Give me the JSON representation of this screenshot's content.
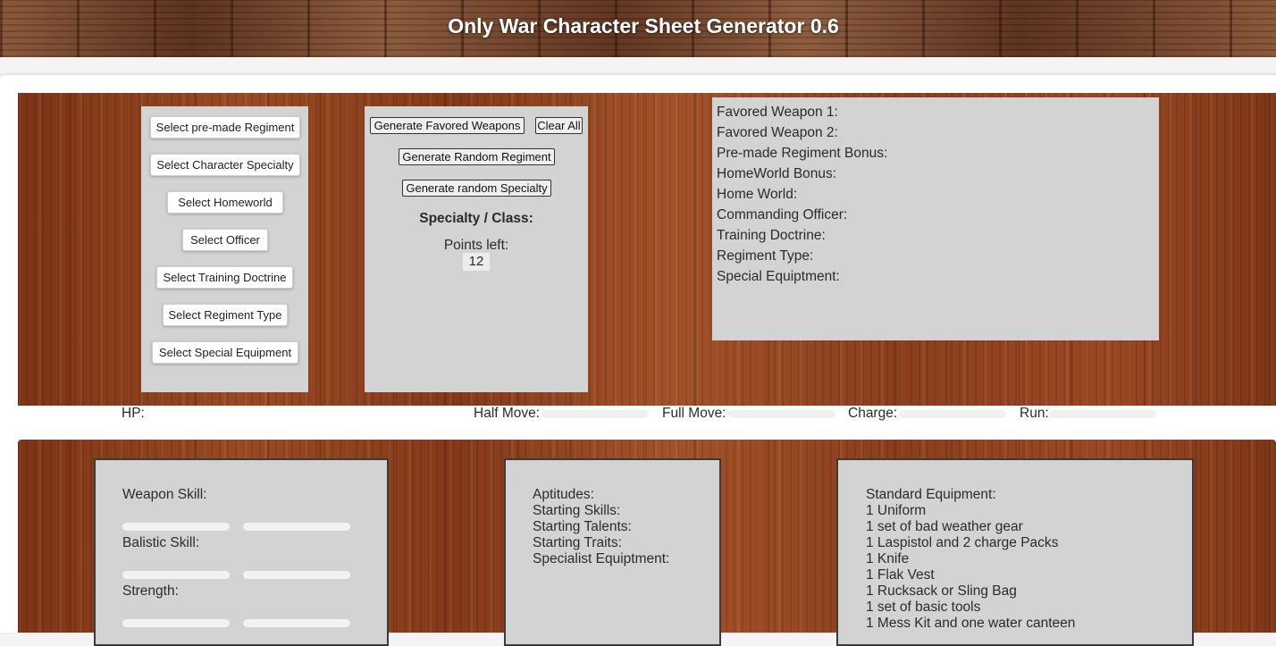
{
  "header": {
    "title": "Only War Character Sheet Generator 0.6"
  },
  "select_buttons": [
    "Select pre-made Regiment",
    "Select Character Specialty",
    "Select Homeworld",
    "Select Officer",
    "Select Training Doctrine",
    "Select Regiment Type",
    "Select Special Equipment"
  ],
  "generate": {
    "favored_weapons": "Generate Favored Weapons",
    "clear_all": "Clear All",
    "random_regiment": "Generate Random Regiment",
    "random_specialty": "Generate random Specialty",
    "specialty_label": "Specialty / Class:",
    "points_left_label": "Points left:",
    "points_left_value": "12"
  },
  "regiment_info": [
    "Favored Weapon 1:",
    "Favored Weapon 2:",
    "Pre-made Regiment Bonus:",
    "HomeWorld Bonus:",
    "Home World:",
    "Commanding Officer:",
    "Training Doctrine:",
    "Regiment Type:",
    "Special Equiptment:"
  ],
  "movement": {
    "hp": "HP:",
    "half_move": "Half Move:",
    "full_move": "Full Move:",
    "charge": "Charge:",
    "run": "Run:"
  },
  "skills": [
    "Weapon Skill:",
    "Balistic Skill:",
    "Strength:"
  ],
  "aptitudes": [
    "Aptitudes:",
    "Starting Skills:",
    "Starting Talents:",
    "Starting Traits:",
    "Specialist Equiptment:"
  ],
  "equipment": [
    "Standard Equipment:",
    "1 Uniform",
    "1 set of bad weather gear",
    "1 Laspistol and 2 charge Packs",
    "1 Knife",
    "1 Flak Vest",
    "1 Rucksack or Sling Bag",
    "1 set of basic tools",
    "1 Mess Kit and one water canteen"
  ]
}
